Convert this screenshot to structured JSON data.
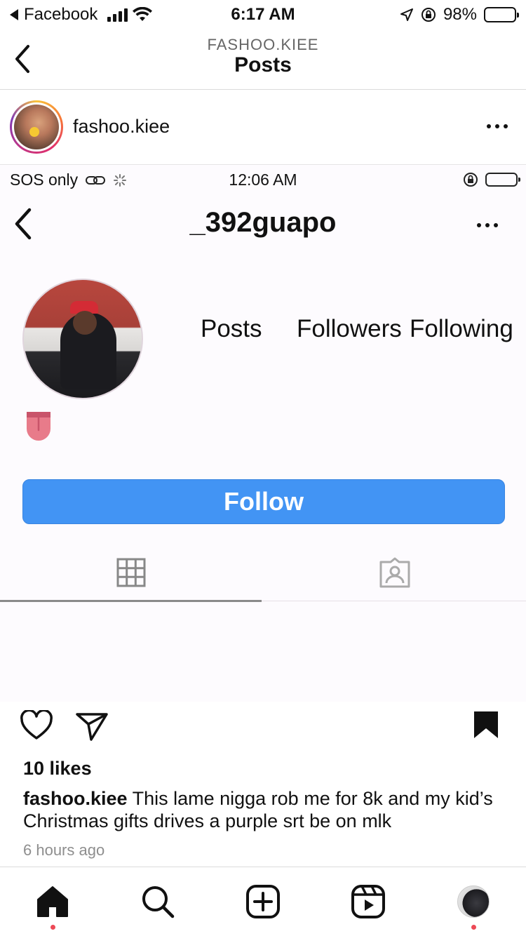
{
  "status_bar": {
    "back_app": "Facebook",
    "time": "6:17 AM",
    "battery": "98%"
  },
  "nav": {
    "subtitle": "FASHOO.KIEE",
    "title": "Posts"
  },
  "post": {
    "username": "fashoo.kiee",
    "image": {
      "status_bar": {
        "carrier": "SOS only",
        "time": "12:06 AM"
      },
      "profile_username": "_392guapo",
      "stats": {
        "posts": "Posts",
        "followers": "Followers",
        "following": "Following"
      },
      "follow_label": "Follow"
    },
    "likes": "10 likes",
    "caption_user": "fashoo.kiee",
    "caption_text": " This lame nigga rob me for 8k and my kid’s Christmas gifts drives a purple srt be on mlk",
    "time_ago": "6 hours ago"
  },
  "colors": {
    "follow_button": "#4294f4",
    "notification_dot": "#ed4956",
    "story_ring": "#e1306c"
  },
  "tabbar": {
    "items": [
      "home-icon",
      "search-icon",
      "new-post-icon",
      "reels-icon",
      "profile-avatar"
    ]
  }
}
